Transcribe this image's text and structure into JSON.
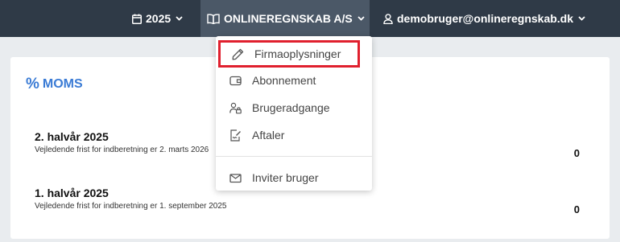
{
  "topbar": {
    "year": {
      "label": "2025",
      "icon": "calendar-icon"
    },
    "company": {
      "label": "ONLINEREGNSKAB A/S",
      "icon": "book-icon"
    },
    "user": {
      "label": "demobruger@onlineregnskab.dk",
      "icon": "user-icon"
    }
  },
  "dropdown": {
    "items": [
      {
        "label": "Firmaoplysninger",
        "icon": "pencil-icon",
        "highlighted": true
      },
      {
        "label": "Abonnement",
        "icon": "wallet-icon"
      },
      {
        "label": "Brugeradgange",
        "icon": "users-lock-icon"
      },
      {
        "label": "Aftaler",
        "icon": "signature-icon"
      },
      {
        "label": "Inviter bruger",
        "icon": "envelope-icon"
      }
    ],
    "highlight_color": "#e0202e"
  },
  "moms": {
    "icon": "%",
    "title": "MOMS",
    "periods": [
      {
        "title": "2. halvår 2025",
        "subtitle": "Vejledende frist for indberetning er 2. marts 2026",
        "value": "0"
      },
      {
        "title": "1. halvår 2025",
        "subtitle": "Vejledende frist for indberetning er 1. september 2025",
        "value": "0"
      }
    ]
  },
  "colors": {
    "topbar": "#2f3a47",
    "topbar_active": "#4b5867",
    "accent": "#3a7bd5",
    "background": "#e9ecef"
  }
}
